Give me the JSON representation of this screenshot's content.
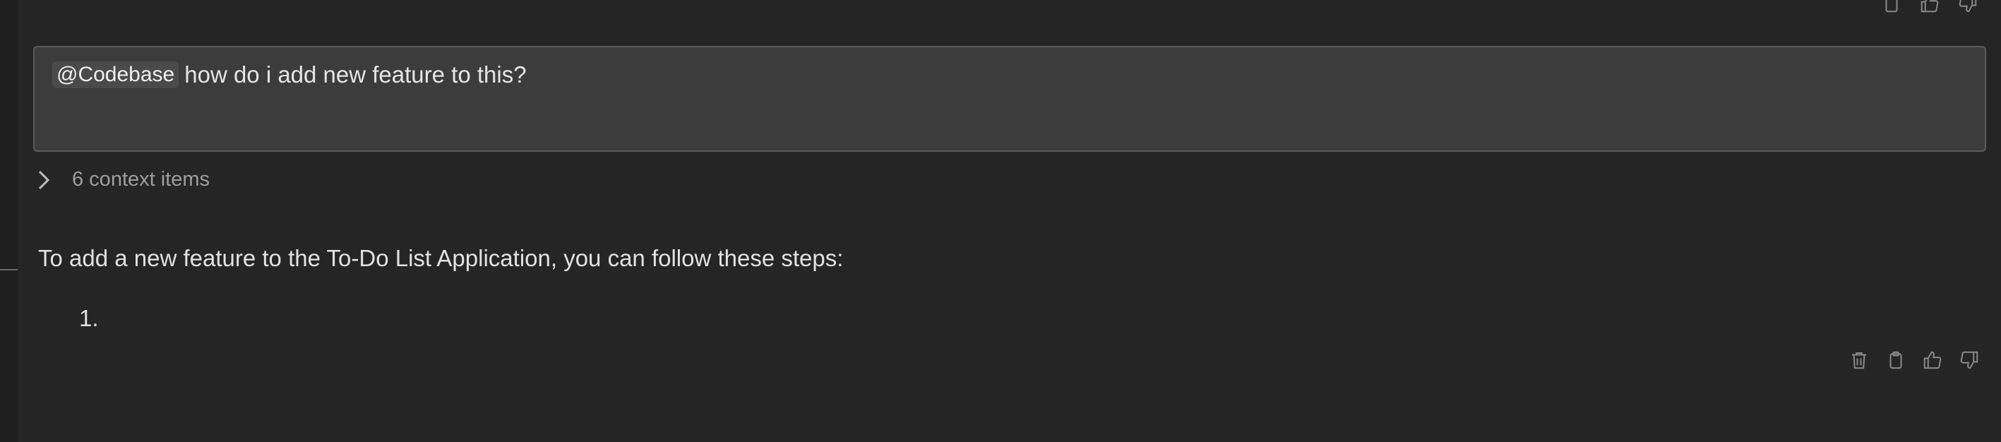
{
  "input": {
    "mention": "@Codebase",
    "text": "how do i add new feature to this?"
  },
  "context": {
    "label": "6 context items"
  },
  "response": {
    "text": "To add a new feature to the To-Do List Application, you can follow these steps:",
    "list_items": [
      "1."
    ]
  },
  "icons": {
    "top": [
      "clipboard-icon",
      "thumbs-up-icon",
      "thumbs-down-icon"
    ],
    "bottom": [
      "trash-icon",
      "clipboard-icon",
      "thumbs-up-icon",
      "thumbs-down-icon"
    ]
  }
}
